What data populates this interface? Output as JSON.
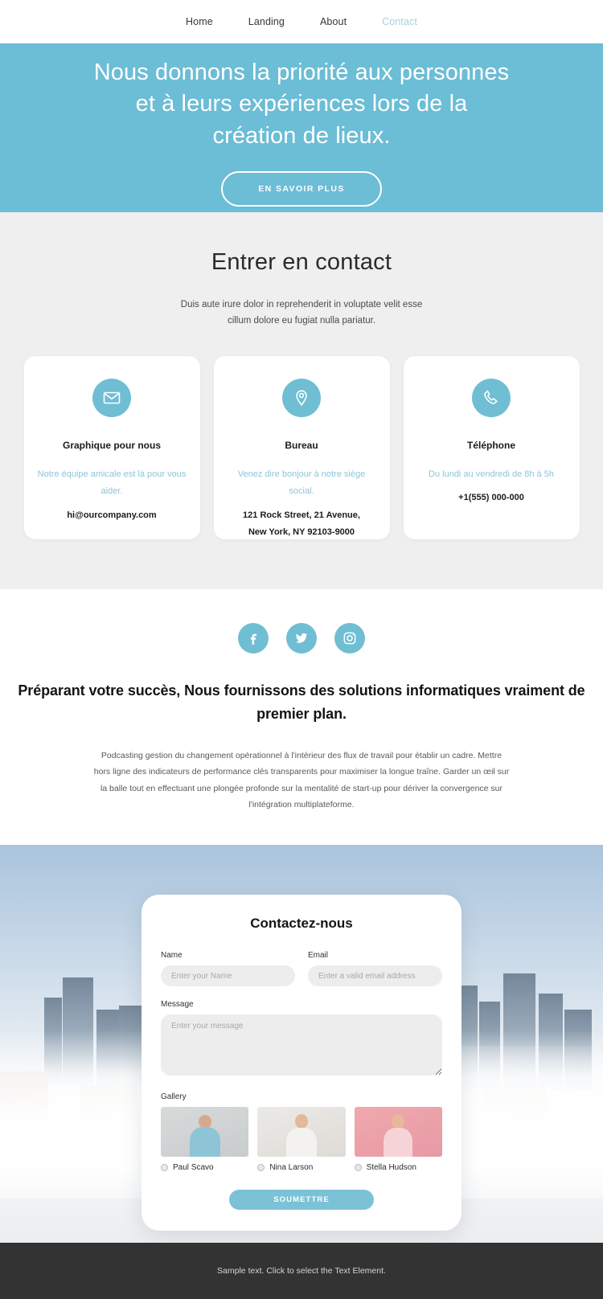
{
  "nav": {
    "items": [
      {
        "label": "Home",
        "active": false
      },
      {
        "label": "Landing",
        "active": false
      },
      {
        "label": "About",
        "active": false
      },
      {
        "label": "Contact",
        "active": true
      }
    ]
  },
  "hero": {
    "title": "Nous donnons la priorité aux personnes et à leurs expériences lors de la création de lieux.",
    "button_label": "EN SAVOIR PLUS",
    "background_color": "#6CBDD6"
  },
  "contact": {
    "title": "Entrer en contact",
    "subtitle": "Duis aute irure dolor in reprehenderit in voluptate velit esse cillum dolore eu fugiat nulla pariatur.",
    "accent_color": "#6FBED3",
    "cards": [
      {
        "icon": "envelope-icon",
        "title": "Graphique pour nous",
        "description": "Notre équipe amicale est là pour vous aider.",
        "value": "hi@ourcompany.com",
        "value2": ""
      },
      {
        "icon": "map-pin-icon",
        "title": "Bureau",
        "description": "Venez dire bonjour à notre siège social.",
        "value": "121 Rock Street, 21 Avenue,",
        "value2": "New York, NY 92103-9000"
      },
      {
        "icon": "phone-icon",
        "title": "Téléphone",
        "description": "Du lundi au vendredi de 8h à 5h",
        "value": "+1(555) 000-000",
        "value2": ""
      }
    ]
  },
  "social": {
    "icons": [
      "facebook-icon",
      "twitter-icon",
      "instagram-icon"
    ],
    "title": "Préparant votre succès, Nous fournissons des solutions informatiques vraiment de premier plan.",
    "body": "Podcasting gestion du changement opérationnel à l'intérieur des flux de travail pour établir un cadre. Mettre hors ligne des indicateurs de performance clés transparents pour maximiser la longue traîne. Garder un œil sur la balle tout en effectuant une plongée profonde sur la mentalité de start-up pour dériver la convergence sur l'intégration multiplateforme."
  },
  "form": {
    "title": "Contactez-nous",
    "name_label": "Name",
    "name_placeholder": "Enter your Name",
    "email_label": "Email",
    "email_placeholder": "Enter a valid email address",
    "message_label": "Message",
    "message_placeholder": "Enter your message",
    "gallery_label": "Gallery",
    "gallery": [
      {
        "name": "Paul Scavo"
      },
      {
        "name": "Nina Larson"
      },
      {
        "name": "Stella Hudson"
      }
    ],
    "submit_label": "SOUMETTRE",
    "submit_color": "#7BC2D6"
  },
  "footer": {
    "text": "Sample text. Click to select the Text Element.",
    "background_color": "#333333"
  }
}
